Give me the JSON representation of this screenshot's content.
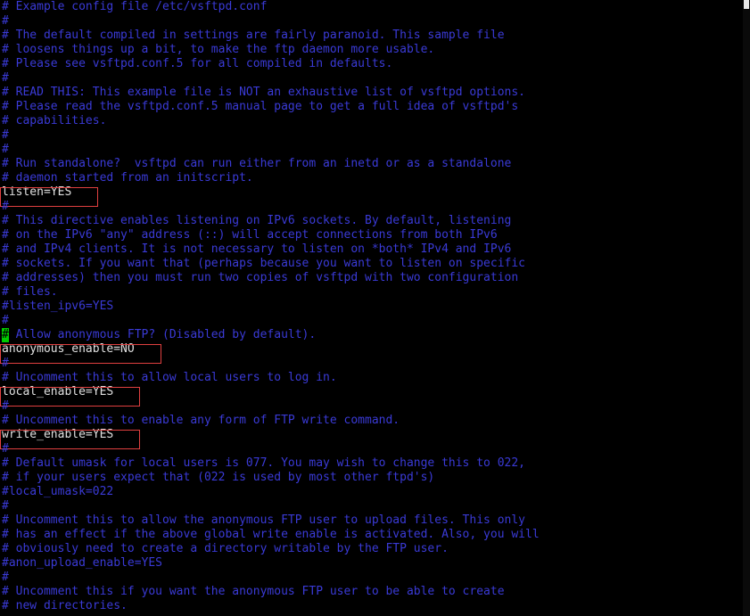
{
  "terminal": {
    "colors": {
      "background": "#000000",
      "comment": "#3a3ad6",
      "setting": "#e0e0e0",
      "highlight_border": "#e04040",
      "cursor": "#00cc00"
    },
    "lines": [
      {
        "text": "# Example config file /etc/vsftpd.conf",
        "kind": "comment"
      },
      {
        "text": "#",
        "kind": "comment"
      },
      {
        "text": "# The default compiled in settings are fairly paranoid. This sample file",
        "kind": "comment"
      },
      {
        "text": "# loosens things up a bit, to make the ftp daemon more usable.",
        "kind": "comment"
      },
      {
        "text": "# Please see vsftpd.conf.5 for all compiled in defaults.",
        "kind": "comment"
      },
      {
        "text": "#",
        "kind": "comment"
      },
      {
        "text": "# READ THIS: This example file is NOT an exhaustive list of vsftpd options.",
        "kind": "comment"
      },
      {
        "text": "# Please read the vsftpd.conf.5 manual page to get a full idea of vsftpd's",
        "kind": "comment"
      },
      {
        "text": "# capabilities.",
        "kind": "comment"
      },
      {
        "text": "#",
        "kind": "comment"
      },
      {
        "text": "#",
        "kind": "comment"
      },
      {
        "text": "# Run standalone?  vsftpd can run either from an inetd or as a standalone",
        "kind": "comment"
      },
      {
        "text": "# daemon started from an initscript.",
        "kind": "comment"
      },
      {
        "text": "listen=YES",
        "kind": "setting",
        "highlighted": true
      },
      {
        "text": "#",
        "kind": "comment"
      },
      {
        "text": "# This directive enables listening on IPv6 sockets. By default, listening",
        "kind": "comment"
      },
      {
        "text": "# on the IPv6 \"any\" address (::) will accept connections from both IPv6",
        "kind": "comment"
      },
      {
        "text": "# and IPv4 clients. It is not necessary to listen on *both* IPv4 and IPv6",
        "kind": "comment"
      },
      {
        "text": "# sockets. If you want that (perhaps because you want to listen on specific",
        "kind": "comment"
      },
      {
        "text": "# addresses) then you must run two copies of vsftpd with two configuration",
        "kind": "comment"
      },
      {
        "text": "# files.",
        "kind": "comment"
      },
      {
        "text": "#listen_ipv6=YES",
        "kind": "comment"
      },
      {
        "text": "#",
        "kind": "comment"
      },
      {
        "text": "# Allow anonymous FTP? (Disabled by default).",
        "kind": "comment",
        "cursor_first_char": true
      },
      {
        "text": "anonymous_enable=NO",
        "kind": "setting",
        "highlighted": true
      },
      {
        "text": "#",
        "kind": "comment"
      },
      {
        "text": "# Uncomment this to allow local users to log in.",
        "kind": "comment"
      },
      {
        "text": "local_enable=YES",
        "kind": "setting",
        "highlighted": true
      },
      {
        "text": "#",
        "kind": "comment"
      },
      {
        "text": "# Uncomment this to enable any form of FTP write command.",
        "kind": "comment"
      },
      {
        "text": "write_enable=YES",
        "kind": "setting",
        "highlighted": true
      },
      {
        "text": "#",
        "kind": "comment"
      },
      {
        "text": "# Default umask for local users is 077. You may wish to change this to 022,",
        "kind": "comment"
      },
      {
        "text": "# if your users expect that (022 is used by most other ftpd's)",
        "kind": "comment"
      },
      {
        "text": "#local_umask=022",
        "kind": "comment"
      },
      {
        "text": "#",
        "kind": "comment"
      },
      {
        "text": "# Uncomment this to allow the anonymous FTP user to upload files. This only",
        "kind": "comment"
      },
      {
        "text": "# has an effect if the above global write enable is activated. Also, you will",
        "kind": "comment"
      },
      {
        "text": "# obviously need to create a directory writable by the FTP user.",
        "kind": "comment"
      },
      {
        "text": "#anon_upload_enable=YES",
        "kind": "comment"
      },
      {
        "text": "#",
        "kind": "comment"
      },
      {
        "text": "# Uncomment this if you want the anonymous FTP user to be able to create",
        "kind": "comment"
      },
      {
        "text": "# new directories.",
        "kind": "comment"
      }
    ]
  }
}
